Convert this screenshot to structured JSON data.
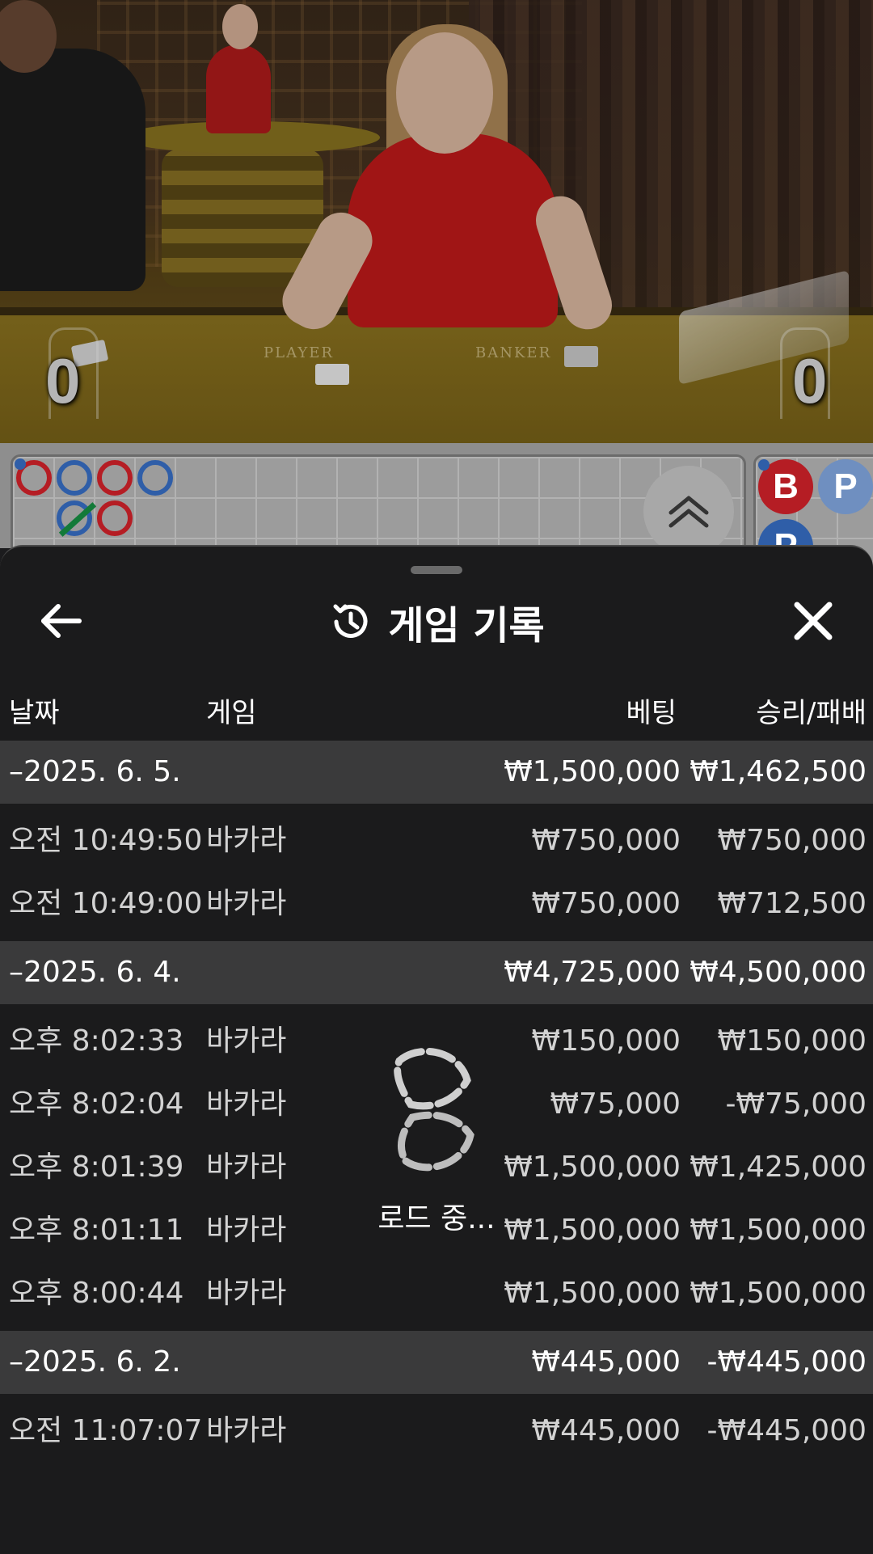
{
  "video": {
    "felt_player": "PLAYER",
    "felt_banker": "BANKER",
    "player_score": "0",
    "banker_score": "0"
  },
  "roadmap": {
    "banker_marker": "B",
    "player_marker": "P",
    "expand_icon": "double-chevron-up-icon"
  },
  "sheet": {
    "title": "게임 기록",
    "back_icon": "arrow-left-icon",
    "history_icon": "history-clock-icon",
    "close_icon": "close-icon"
  },
  "columns": {
    "date": "날짜",
    "game": "게임",
    "bet": "베팅",
    "win_loss": "승리/패배"
  },
  "groups": [
    {
      "date": "–2025. 6. 5.",
      "bet": "₩1,500,000",
      "win_loss": "₩1,462,500",
      "rows": [
        {
          "time": "오전 10:49:50",
          "game": "바카라",
          "bet": "₩750,000",
          "win_loss": "₩750,000"
        },
        {
          "time": "오전 10:49:00",
          "game": "바카라",
          "bet": "₩750,000",
          "win_loss": "₩712,500"
        }
      ]
    },
    {
      "date": "–2025. 6. 4.",
      "bet": "₩4,725,000",
      "win_loss": "₩4,500,000",
      "rows": [
        {
          "time": "오후 8:02:33",
          "game": "바카라",
          "bet": "₩150,000",
          "win_loss": "₩150,000"
        },
        {
          "time": "오후 8:02:04",
          "game": "바카라",
          "bet": "₩75,000",
          "win_loss": "-₩75,000"
        },
        {
          "time": "오후 8:01:39",
          "game": "바카라",
          "bet": "₩1,500,000",
          "win_loss": "₩1,425,000"
        },
        {
          "time": "오후 8:01:11",
          "game": "바카라",
          "bet": "₩1,500,000",
          "win_loss": "₩1,500,000"
        },
        {
          "time": "오후 8:00:44",
          "game": "바카라",
          "bet": "₩1,500,000",
          "win_loss": "₩1,500,000"
        }
      ]
    },
    {
      "date": "–2025. 6. 2.",
      "bet": "₩445,000",
      "win_loss": "-₩445,000",
      "rows": [
        {
          "time": "오전 11:07:07",
          "game": "바카라",
          "bet": "₩445,000",
          "win_loss": "-₩445,000"
        }
      ]
    }
  ],
  "loading": {
    "text": "로드 중...",
    "icon": "loading-spinner-icon"
  },
  "colors": {
    "sheet_bg": "#1b1b1c",
    "group_bg": "#3a3a3b",
    "banker_red": "#b51d24",
    "player_blue": "#2f5ea8"
  }
}
